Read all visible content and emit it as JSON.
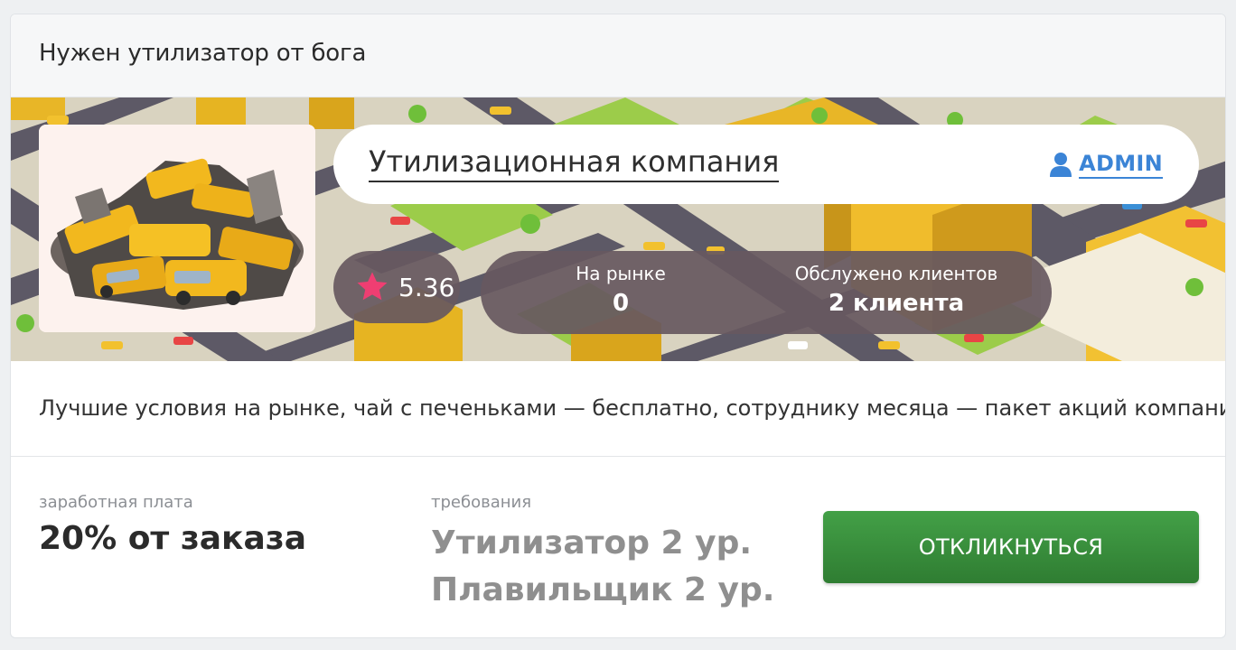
{
  "job": {
    "title": "Нужен утилизатор от бога",
    "description": "Лучшие условия на рынке, чай с печеньками — бесплатно, сотруднику месяца — пакет акций компании"
  },
  "company": {
    "name": "Утилизационная компания",
    "owner": "ADMIN",
    "rating": "5.36",
    "stats": {
      "market_label": "На рынке",
      "market_value": "0",
      "clients_label": "Обслужено клиентов",
      "clients_value": "2 клиента"
    }
  },
  "offer": {
    "salary_label": "заработная плата",
    "salary_value": "20% от заказа",
    "requirements_label": "требования",
    "requirements": [
      "Утилизатор 2 ур.",
      "Плавильщик 2 ур."
    ]
  },
  "actions": {
    "apply_label": "ОТКЛИКНУТЬСЯ"
  },
  "colors": {
    "accent_green": "#2f7d32",
    "link_blue": "#3b84d6",
    "star_pink": "#ef3e72",
    "pill_overlay": "#675860"
  },
  "icons": {
    "owner": "user-icon",
    "rating": "star-icon",
    "company_logo": "taxi-scrap-heap-image",
    "banner": "isometric-city-banner-image"
  }
}
